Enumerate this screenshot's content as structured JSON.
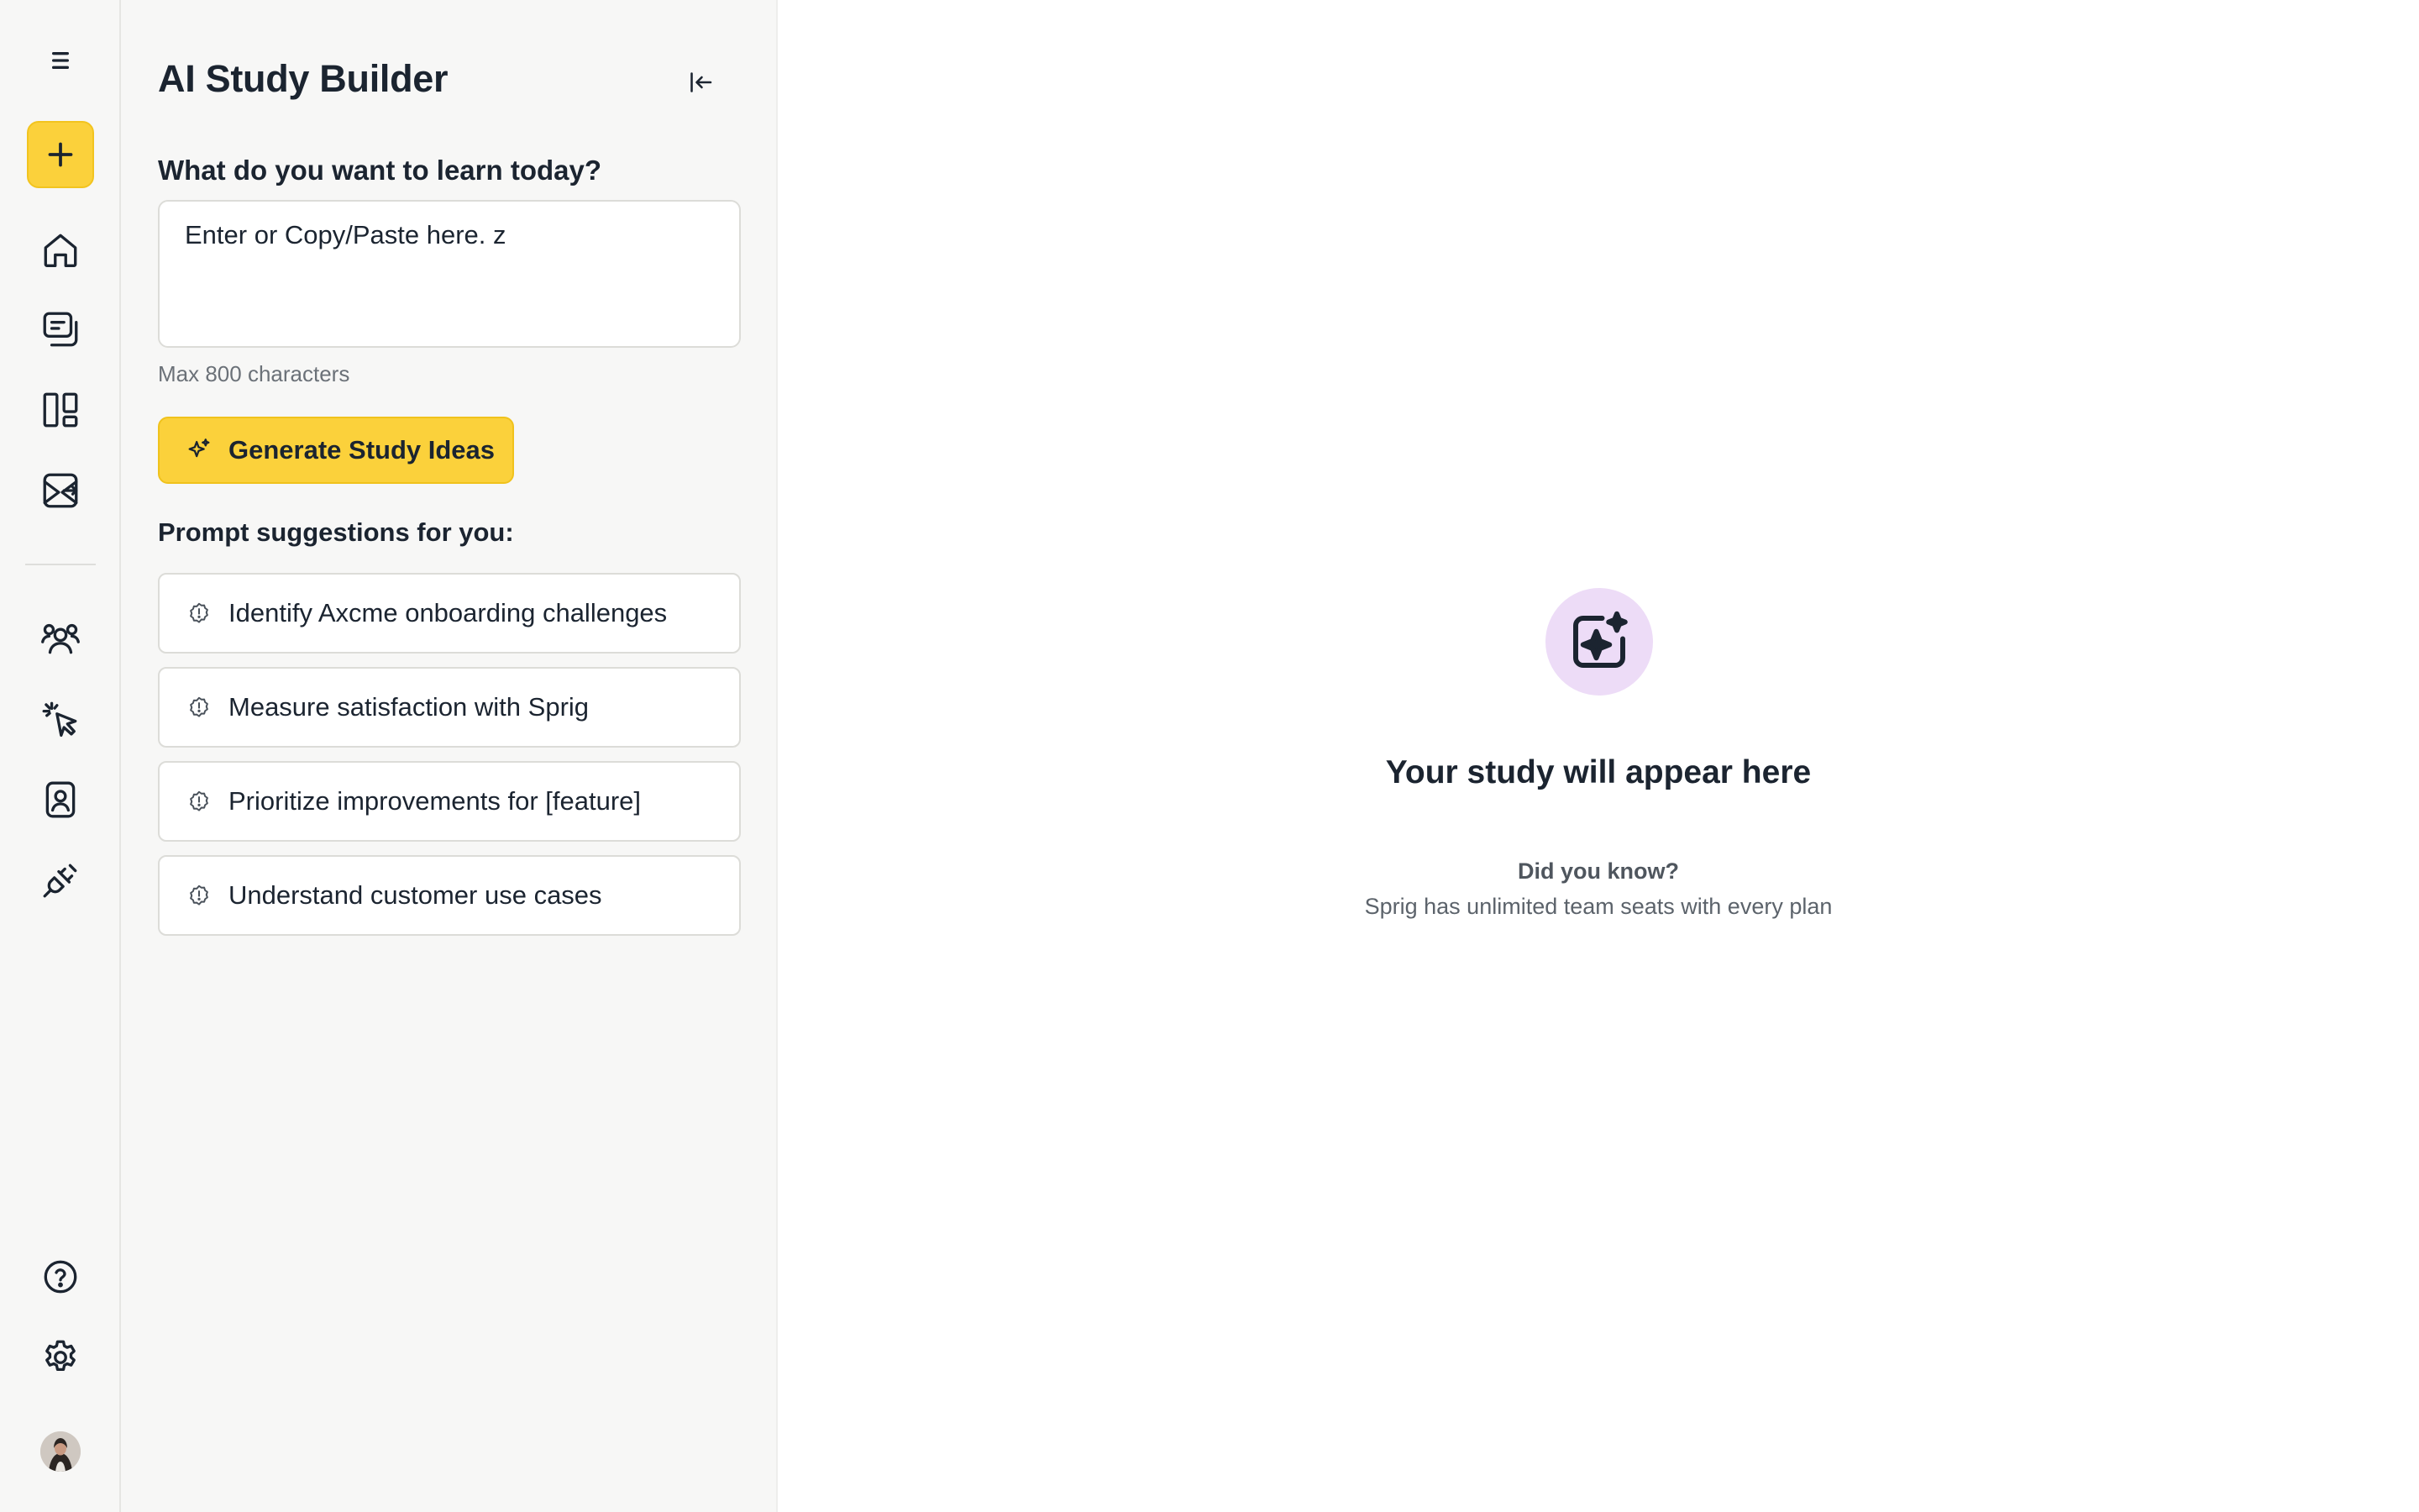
{
  "rail": {
    "items": [
      {
        "icon": "menu-icon"
      },
      {
        "icon": "plus-icon",
        "label": "Create"
      },
      {
        "icon": "home-icon"
      },
      {
        "icon": "studies-icon"
      },
      {
        "icon": "dashboard-icon"
      },
      {
        "icon": "insights-icon"
      },
      {
        "icon": "team-icon"
      },
      {
        "icon": "click-cursor-icon"
      },
      {
        "icon": "contact-badge-icon"
      },
      {
        "icon": "plug-icon"
      },
      {
        "icon": "help-icon"
      },
      {
        "icon": "settings-icon"
      }
    ],
    "avatar": "user-avatar"
  },
  "builder": {
    "title": "AI Study Builder",
    "question": "What do you want to learn today?",
    "input_value": "Enter or Copy/Paste here. z",
    "hint": "Max 800 characters",
    "generate_label": "Generate Study Ideas",
    "suggestions_title": "Prompt suggestions for you:",
    "suggestions": [
      {
        "label": "Identify Axcme onboarding challenges"
      },
      {
        "label": "Measure satisfaction with Sprig"
      },
      {
        "label": "Prioritize improvements for [feature]"
      },
      {
        "label": "Understand customer use cases"
      }
    ]
  },
  "main": {
    "empty_title": "Your study will appear here",
    "did_you_know": "Did you know?",
    "tip": "Sprig has unlimited team seats with every plan"
  },
  "colors": {
    "accent": "#fbd13b",
    "sparkle_bg": "#eddcf7",
    "text": "#1b2430",
    "panel_bg": "#f7f7f6"
  }
}
